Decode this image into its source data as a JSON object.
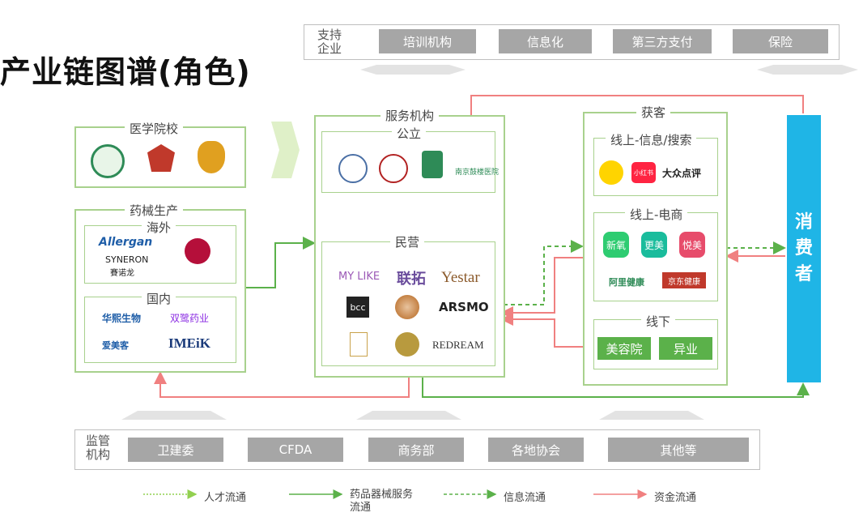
{
  "page_title": "产业链图谱(角色)",
  "support": {
    "label_line1": "支持",
    "label_line2": "企业",
    "items": [
      "培训机构",
      "信息化",
      "第三方支付",
      "保险"
    ]
  },
  "regulators": {
    "label_line1": "监管",
    "label_line2": "机构",
    "items": [
      "卫建委",
      "CFDA",
      "商务部",
      "各地协会",
      "其他等"
    ]
  },
  "medical_schools": {
    "label": "医学院校"
  },
  "pharma": {
    "label": "药械生产",
    "overseas": {
      "label": "海外",
      "logos": [
        "Allergan",
        "SYNERON",
        "賽诺龙",
        "LG"
      ]
    },
    "domestic": {
      "label": "国内",
      "logos": [
        "华熙生物",
        "双鹭药业",
        "爱美客",
        "IMEiK"
      ]
    }
  },
  "service_org": {
    "label": "服务机构",
    "public": {
      "label": "公立",
      "logos": [
        "南京鼓楼医院"
      ]
    },
    "private": {
      "label": "民营",
      "logos": [
        "MY LIKE",
        "联拓",
        "Yestar",
        "bcc",
        "ARSMO",
        "REDREAM"
      ]
    }
  },
  "acquisition": {
    "label": "获客",
    "online_info": {
      "label": "线上-信息/搜索",
      "logos": [
        "小红书",
        "大众点评"
      ]
    },
    "online_ecom": {
      "label": "线上-电商",
      "logos": [
        "新氧",
        "更美",
        "悦美",
        "阿里健康",
        "京东健康"
      ]
    },
    "offline": {
      "label": "线下",
      "items": [
        "美容院",
        "异业"
      ]
    }
  },
  "consumer": {
    "chars": [
      "消",
      "费",
      "者"
    ]
  },
  "legend": [
    {
      "label": "人才流通",
      "color": "#92d050",
      "style": "dotted"
    },
    {
      "label": "药品器械服务流通",
      "color": "#5bb14a",
      "style": "solid"
    },
    {
      "label": "信息流通",
      "color": "#5bb14a",
      "style": "dashed"
    },
    {
      "label": "资金流通",
      "color": "#f08080",
      "style": "solid"
    }
  ],
  "colors": {
    "green_border": "#a8d18d",
    "green_btn": "#5bb14a",
    "gray_btn": "#a6a6a6",
    "consumer": "#1fb5e6",
    "money": "#f08080"
  }
}
